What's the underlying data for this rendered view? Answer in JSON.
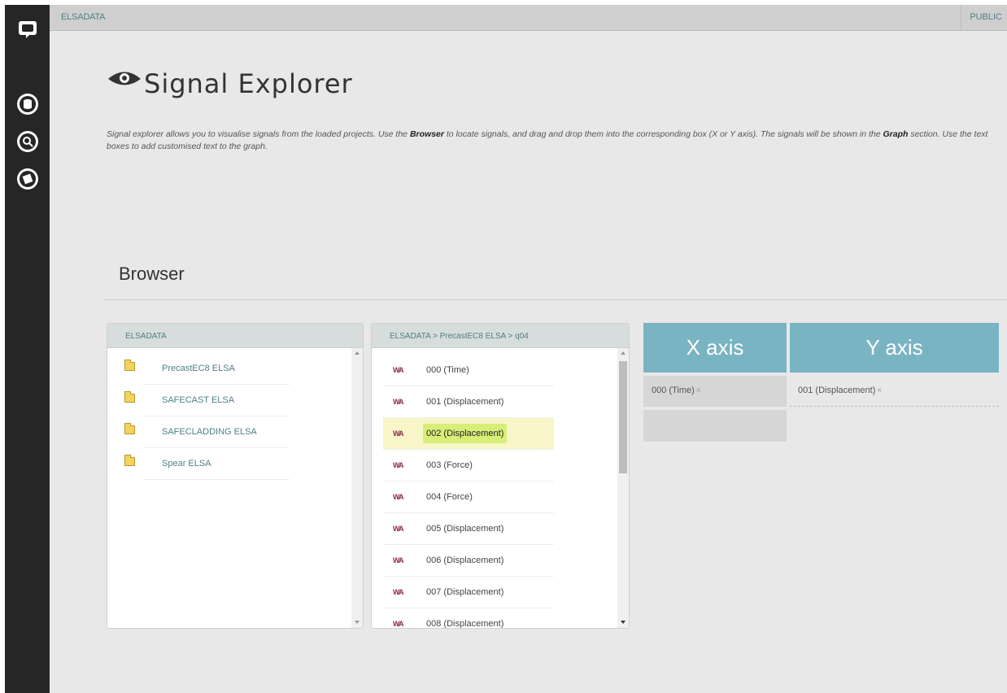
{
  "app": {
    "breadcrumb": "ELSADATA",
    "public_label": "PUBLIC"
  },
  "page": {
    "title": "Signal Explorer",
    "intro_1": "Signal explorer allows you to visualise signals from the loaded projects. Use the ",
    "intro_bold_1": "Browser",
    "intro_2": " to locate signals, and drag and drop them into the corresponding box (X or Y axis). The signals will be shown in the ",
    "intro_bold_2": "Graph",
    "intro_3": " section. Use the text boxes to add customised text to the graph."
  },
  "sidebar": {
    "items": [
      {
        "icon": "chat-logo-icon"
      },
      {
        "icon": "database-icon"
      },
      {
        "icon": "search-icon"
      },
      {
        "icon": "manual-icon"
      }
    ]
  },
  "browser": {
    "section_title": "Browser",
    "projects_panel": {
      "header": "ELSADATA",
      "folders": [
        "PrecastEC8 ELSA",
        "SAFECAST ELSA",
        "SAFECLADDING ELSA",
        "Spear ELSA"
      ]
    },
    "signals_panel": {
      "header": "ELSADATA  >  PrecastEC8 ELSA  >  q04",
      "wave_glyph": "WA",
      "signals": [
        {
          "label": "000 (Time)",
          "selected": false
        },
        {
          "label": "001 (Displacement)",
          "selected": false
        },
        {
          "label": "002 (Displacement)",
          "selected": true
        },
        {
          "label": "003 (Force)",
          "selected": false
        },
        {
          "label": "004 (Force)",
          "selected": false
        },
        {
          "label": "005 (Displacement)",
          "selected": false
        },
        {
          "label": "006 (Displacement)",
          "selected": false
        },
        {
          "label": "007 (Displacement)",
          "selected": false
        },
        {
          "label": "008 (Displacement)",
          "selected": false
        }
      ]
    }
  },
  "axes": {
    "x_title": "X axis",
    "y_title": "Y axis",
    "x_signal": "000 (Time)",
    "y_signal": "001 (Displacement)",
    "remove_glyph": "×"
  },
  "colors": {
    "accent": "#79b4c2",
    "link": "#4e7f86",
    "sidebar": "#262626",
    "selected_row": "#f8f6c8",
    "selected_label": "#d9ee79"
  }
}
